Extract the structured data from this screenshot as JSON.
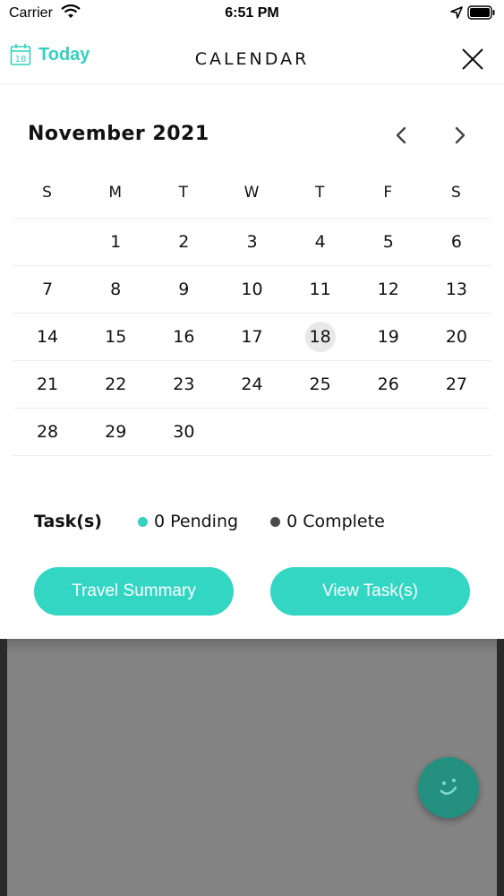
{
  "status_bar": {
    "carrier": "Carrier",
    "time": "6:51 PM"
  },
  "header": {
    "today_icon_day": "18",
    "today_label": "Today",
    "title": "CALENDAR",
    "close_icon": "close-icon"
  },
  "calendar": {
    "month_title": "November 2021",
    "weekdays": [
      "S",
      "M",
      "T",
      "W",
      "T",
      "F",
      "S"
    ],
    "weeks": [
      [
        "",
        "1",
        "2",
        "3",
        "4",
        "5",
        "6"
      ],
      [
        "7",
        "8",
        "9",
        "10",
        "11",
        "12",
        "13"
      ],
      [
        "14",
        "15",
        "16",
        "17",
        "18",
        "19",
        "20"
      ],
      [
        "21",
        "22",
        "23",
        "24",
        "25",
        "26",
        "27"
      ],
      [
        "28",
        "29",
        "30",
        "",
        "",
        "",
        ""
      ]
    ],
    "selected_day": "18"
  },
  "tasks": {
    "label": "Task(s)",
    "pending": "0 Pending",
    "complete": "0 Complete"
  },
  "buttons": {
    "travel_summary": "Travel Summary",
    "view_tasks": "View Task(s)"
  },
  "colors": {
    "accent": "#33d1bf",
    "button": "#33d6c3",
    "fab": "#24907f",
    "complete_dot": "#4a4a4a"
  }
}
